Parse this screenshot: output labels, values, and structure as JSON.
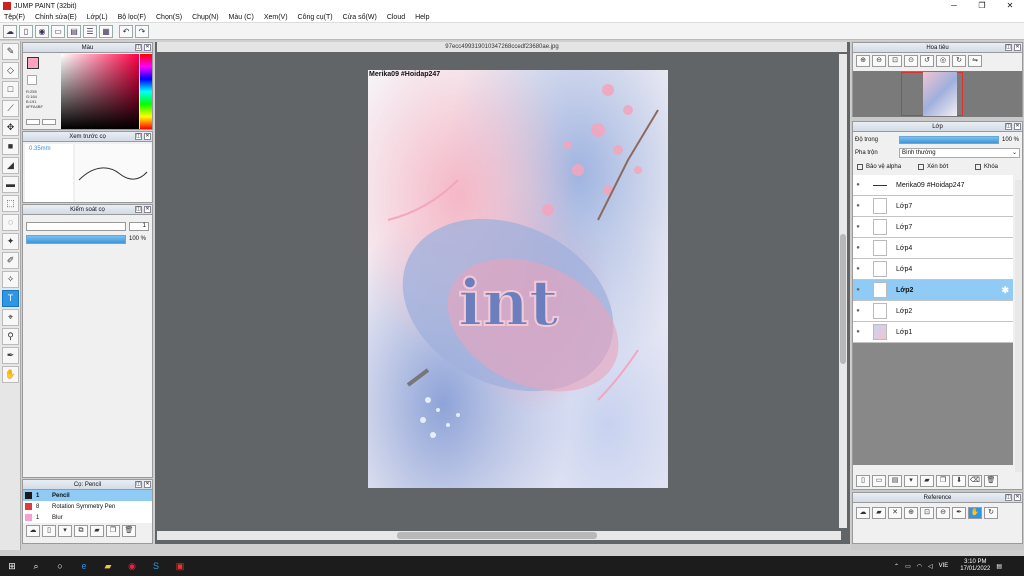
{
  "window": {
    "title": "JUMP PAINT (32bit)",
    "min": "─",
    "max": "❐",
    "close": "✕"
  },
  "menu": [
    "Tệp(F)",
    "Chỉnh sửa(E)",
    "Lớp(L)",
    "Bộ lọc(F)",
    "Chọn(S)",
    "Chụp(N)",
    "Màu (C)",
    "Xem(V)",
    "Công cụ(T)",
    "Cửa sổ(W)",
    "Cloud",
    "Help"
  ],
  "toolbar_icons": [
    "cloud-icon",
    "new-icon",
    "chat-icon",
    "comment-icon",
    "page-icon",
    "list-icon",
    "grid-icon",
    "undo-icon",
    "redo-icon"
  ],
  "color_panel": {
    "title": "Màu",
    "values": [
      "R:255",
      "G:164",
      "B:191",
      "#FFA4BF"
    ],
    "color": "#FFA4BF"
  },
  "preview_panel": {
    "title": "Xem trước cọ",
    "size": "0.35mm"
  },
  "brush_control": {
    "title": "Kiểm soát cọ",
    "size_value": "1",
    "opacity_value": "100 %"
  },
  "brush_panel": {
    "title": "Cọ: Pencil",
    "items": [
      {
        "num": "1",
        "name": "Pencil",
        "color": "#1a1a1a"
      },
      {
        "num": "8",
        "name": "Rotation Symmetry Pen",
        "color": "#e03a3a"
      },
      {
        "num": "1",
        "name": "Blur",
        "color": "#f5a0d0"
      }
    ]
  },
  "document": {
    "tab": "97ecc499319010347268ccedf23680ae.jpg",
    "caption": "Merika09 #Hoidap247"
  },
  "navigator": {
    "title": "Hoa tiêu"
  },
  "layer_panel": {
    "title": "Lớp",
    "opacity_label": "Độ trong",
    "opacity_value": "100 %",
    "blend_label": "Pha trộn",
    "blend_value": "Bình thường",
    "protect_alpha": "Bảo vệ alpha",
    "clip": "Xén bớt",
    "lock": "Khóa",
    "layers": [
      "Merika09 #Hoidap247",
      "Lớp7",
      "Lớp7",
      "Lớp4",
      "Lớp4",
      "Lớp2",
      "Lớp2",
      "Lớp1"
    ],
    "selected_index": 5
  },
  "reference_panel": {
    "title": "Reference"
  },
  "taskbar": {
    "time": "3:10 PM",
    "date": "17/01/2022",
    "lang": "VIE",
    "icons": [
      "windows-icon",
      "search-icon",
      "task-view-icon",
      "edge-icon",
      "file-explorer-icon",
      "chrome-icon",
      "skype-icon",
      "jump-paint-icon"
    ]
  }
}
